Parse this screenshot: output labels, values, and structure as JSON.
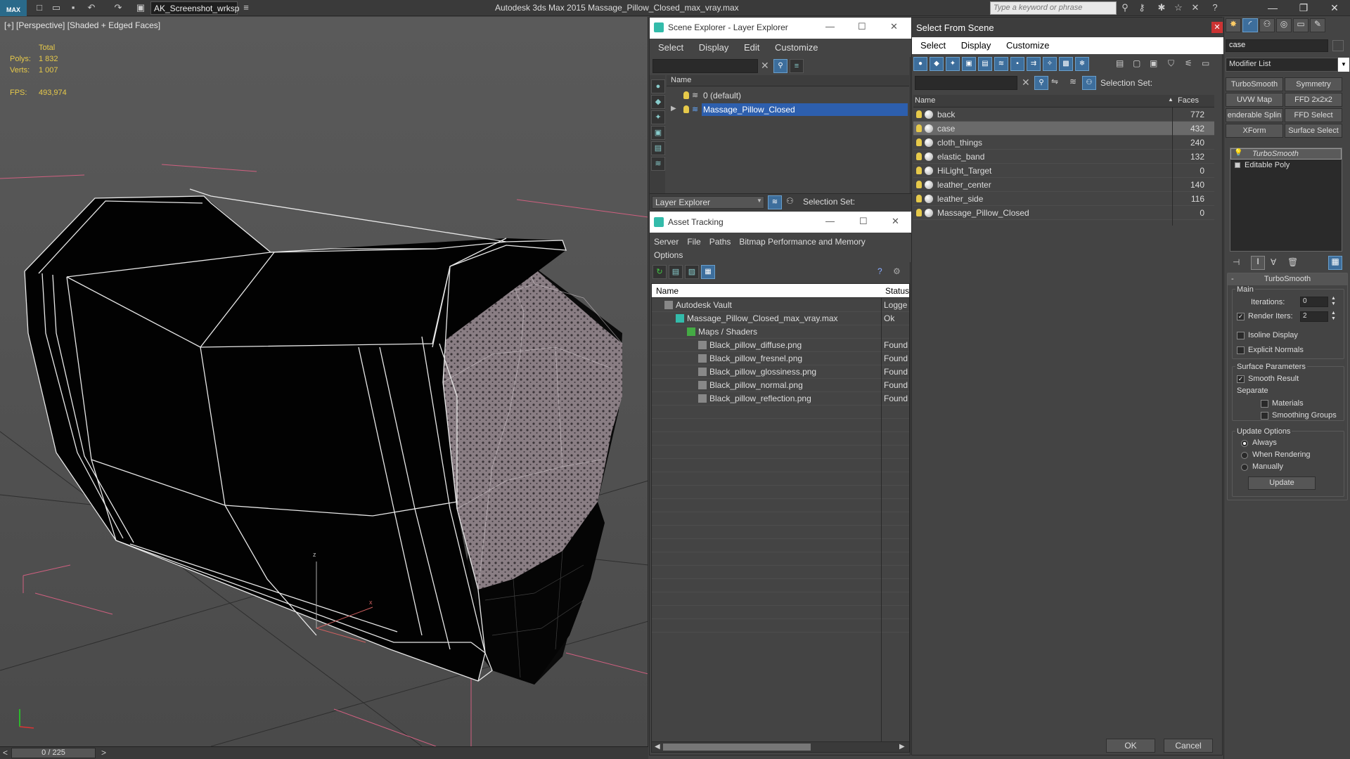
{
  "app": {
    "logo": "MAX",
    "workspace": "AK_Screenshot_wrksp",
    "title": "Autodesk 3ds Max  2015     Massage_Pillow_Closed_max_vray.max",
    "search_placeholder": "Type a keyword or phrase"
  },
  "viewport": {
    "label": "[+] [Perspective] [Shaded + Edged Faces]",
    "stats": {
      "total_label": "Total",
      "polys_label": "Polys:",
      "polys_value": "1 832",
      "verts_label": "Verts:",
      "verts_value": "1 007",
      "fps_label": "FPS:",
      "fps_value": "493,974"
    },
    "axis_z": "z",
    "axis_x": "x"
  },
  "timeline": {
    "prev": "<",
    "frame": "0 / 225",
    "next": ">"
  },
  "scene_explorer": {
    "title": "Scene Explorer - Layer Explorer",
    "menu": [
      "Select",
      "Display",
      "Edit",
      "Customize"
    ],
    "column_name": "Name",
    "layers": [
      {
        "name": "0 (default)"
      },
      {
        "name": "Massage_Pillow_Closed"
      }
    ],
    "footer_dropdown": "Layer Explorer",
    "selection_set_label": "Selection Set:"
  },
  "asset_tracking": {
    "title": "Asset Tracking",
    "menu": [
      "Server",
      "File",
      "Paths",
      "Bitmap Performance and Memory"
    ],
    "menu2": "Options",
    "col_name": "Name",
    "col_status": "Status",
    "rows": [
      {
        "name": "Autodesk Vault",
        "status": "Logge",
        "indent": 0
      },
      {
        "name": "Massage_Pillow_Closed_max_vray.max",
        "status": "Ok",
        "indent": 1
      },
      {
        "name": "Maps / Shaders",
        "status": "",
        "indent": 2
      },
      {
        "name": "Black_pillow_diffuse.png",
        "status": "Found",
        "indent": 3
      },
      {
        "name": "Black_pillow_fresnel.png",
        "status": "Found",
        "indent": 3
      },
      {
        "name": "Black_pillow_glossiness.png",
        "status": "Found",
        "indent": 3
      },
      {
        "name": "Black_pillow_normal.png",
        "status": "Found",
        "indent": 3
      },
      {
        "name": "Black_pillow_reflection.png",
        "status": "Found",
        "indent": 3
      }
    ]
  },
  "select_from_scene": {
    "title": "Select From Scene",
    "menu": [
      "Select",
      "Display",
      "Customize"
    ],
    "selection_set_label": "Selection Set:",
    "col_name": "Name",
    "col_faces": "Faces",
    "objects": [
      {
        "name": "back",
        "faces": "772"
      },
      {
        "name": "case",
        "faces": "432"
      },
      {
        "name": "cloth_things",
        "faces": "240"
      },
      {
        "name": "elastic_band",
        "faces": "132"
      },
      {
        "name": "HiLight_Target",
        "faces": "0"
      },
      {
        "name": "leather_center",
        "faces": "140"
      },
      {
        "name": "leather_side",
        "faces": "116"
      },
      {
        "name": "Massage_Pillow_Closed",
        "faces": "0"
      }
    ],
    "selected_index": 1,
    "ok": "OK",
    "cancel": "Cancel"
  },
  "command_panel": {
    "object_name": "case",
    "modifier_list": "Modifier List",
    "mod_buttons": [
      "TurboSmooth",
      "Symmetry",
      "UVW Map",
      "FFD 2x2x2",
      "enderable Splin",
      "FFD Select",
      "XForm",
      "Surface Select"
    ],
    "stack": [
      "TurboSmooth",
      "Editable Poly"
    ],
    "rollout_title": "TurboSmooth",
    "main_label": "Main",
    "iterations_label": "Iterations:",
    "iterations_value": "0",
    "render_iters_label": "Render Iters:",
    "render_iters_value": "2",
    "isoline": "Isoline Display",
    "explicit_normals": "Explicit Normals",
    "surface_params": "Surface Parameters",
    "smooth_result": "Smooth Result",
    "separate": "Separate",
    "materials": "Materials",
    "smoothing_groups": "Smoothing Groups",
    "update_options": "Update Options",
    "always": "Always",
    "when_rendering": "When Rendering",
    "manually": "Manually",
    "update_button": "Update"
  }
}
